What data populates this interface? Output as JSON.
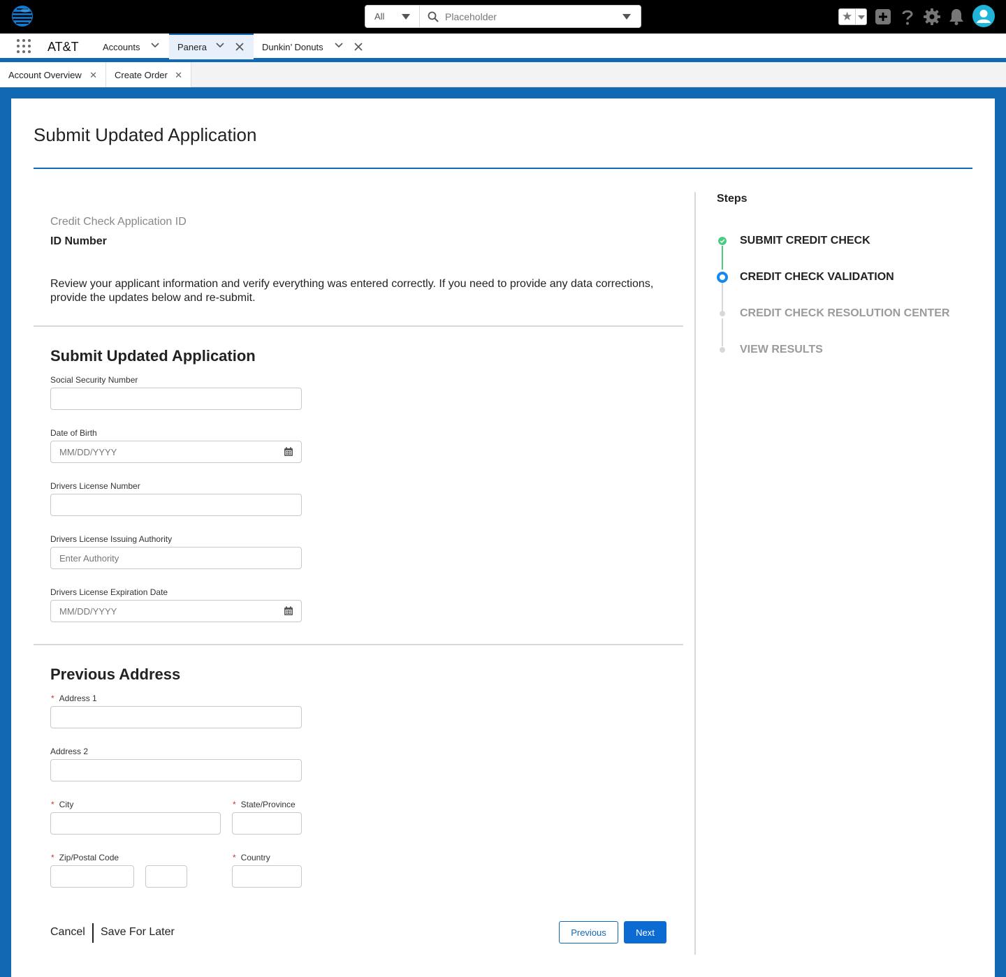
{
  "topbar": {
    "search_scope": "All",
    "search_placeholder": "Placeholder",
    "icons": [
      "att-logo",
      "favorites-star-icon",
      "add-icon",
      "help-icon",
      "gear-icon",
      "notification-bell-icon",
      "user-avatar-icon"
    ]
  },
  "nav": {
    "app_name": "AT&T",
    "items": [
      {
        "label": "Accounts"
      },
      {
        "label": "Panera"
      },
      {
        "label": "Dunkin’ Donuts"
      }
    ]
  },
  "subtabs": [
    {
      "label": "Account Overview"
    },
    {
      "label": "Create Order"
    }
  ],
  "page": {
    "title": "Submit Updated Application",
    "ccid_label": "Credit Check Application ID",
    "ccid_value": "ID Number",
    "review_text": "Review your applicant information and verify everything was entered correctly. If you need to provide any data corrections, provide the updates below and re-submit."
  },
  "application_form": {
    "section_title": "Submit Updated Application",
    "ssn_label": "Social Security Number",
    "ssn_value": "",
    "dob_label": "Date of Birth",
    "dob_placeholder": "MM/DD/YYYY",
    "dl_number_label": "Drivers License Number",
    "dl_number_value": "",
    "dl_authority_label": "Drivers License Issuing Authority",
    "dl_authority_placeholder": "Enter Authority",
    "dl_expiration_label": "Drivers License Expiration Date",
    "dl_expiration_placeholder": "MM/DD/YYYY"
  },
  "address_form": {
    "section_title": "Previous Address",
    "required_mark": "*",
    "address1_label": "Address 1",
    "address2_label": "Address 2",
    "city_label": "City",
    "state_label": "State/Province",
    "zip_label": "Zip/Postal Code",
    "country_label": "Country"
  },
  "footer": {
    "cancel_label": "Cancel",
    "save_label": "Save For Later",
    "previous_label": "Previous",
    "next_label": "Next"
  },
  "steps": {
    "title": "Steps",
    "items": [
      {
        "label": "SUBMIT CREDIT CHECK",
        "status": "complete"
      },
      {
        "label": "CREDIT CHECK VALIDATION",
        "status": "current"
      },
      {
        "label": "CREDIT CHECK RESOLUTION CENTER",
        "status": "upcoming"
      },
      {
        "label": "VIEW RESULTS",
        "status": "upcoming"
      }
    ]
  },
  "colors": {
    "brand_blue": "#1168b3",
    "complete_green": "#4bca81",
    "current_blue": "#1589ee",
    "upcoming_gray": "#9b9b9b",
    "required_red": "#c23934"
  }
}
